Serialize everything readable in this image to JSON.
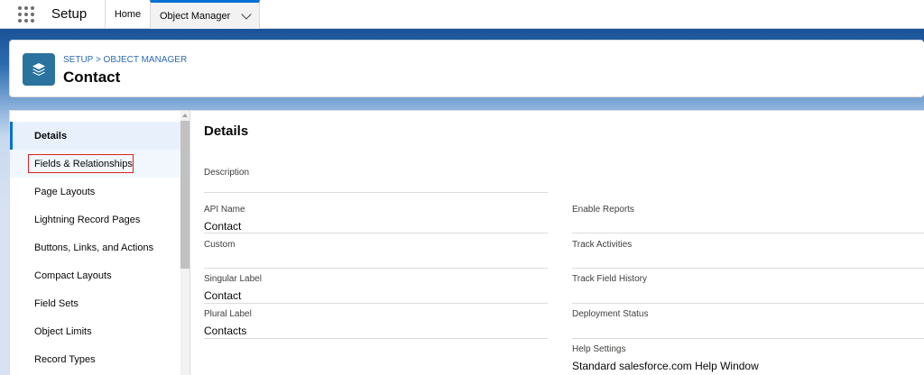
{
  "topnav": {
    "app_name": "Setup",
    "tabs": [
      {
        "label": "Home"
      },
      {
        "label": "Object Manager"
      }
    ]
  },
  "header": {
    "breadcrumb": "SETUP > OBJECT MANAGER",
    "title": "Contact"
  },
  "sidebar": {
    "items": [
      {
        "label": "Details",
        "active": true
      },
      {
        "label": "Fields & Relationships",
        "highlighted": true
      },
      {
        "label": "Page Layouts"
      },
      {
        "label": "Lightning Record Pages"
      },
      {
        "label": "Buttons, Links, and Actions"
      },
      {
        "label": "Compact Layouts"
      },
      {
        "label": "Field Sets"
      },
      {
        "label": "Object Limits"
      },
      {
        "label": "Record Types"
      }
    ]
  },
  "details": {
    "title": "Details",
    "description_label": "Description",
    "description_value": "",
    "left_fields": [
      {
        "label": "API Name",
        "value": "Contact"
      },
      {
        "label": "Custom",
        "value": ""
      },
      {
        "label": "Singular Label",
        "value": "Contact"
      },
      {
        "label": "Plural Label",
        "value": "Contacts"
      }
    ],
    "right_fields": [
      {
        "label": "Enable Reports",
        "value": ""
      },
      {
        "label": "Track Activities",
        "value": ""
      },
      {
        "label": "Track Field History",
        "value": ""
      },
      {
        "label": "Deployment Status",
        "value": ""
      },
      {
        "label": "Help Settings",
        "value": "Standard salesforce.com Help Window"
      }
    ]
  },
  "colors": {
    "accent": "#0070d2",
    "brand_band": "#1b5297",
    "object_icon": "#2a739e",
    "highlight_box": "#e02020"
  }
}
